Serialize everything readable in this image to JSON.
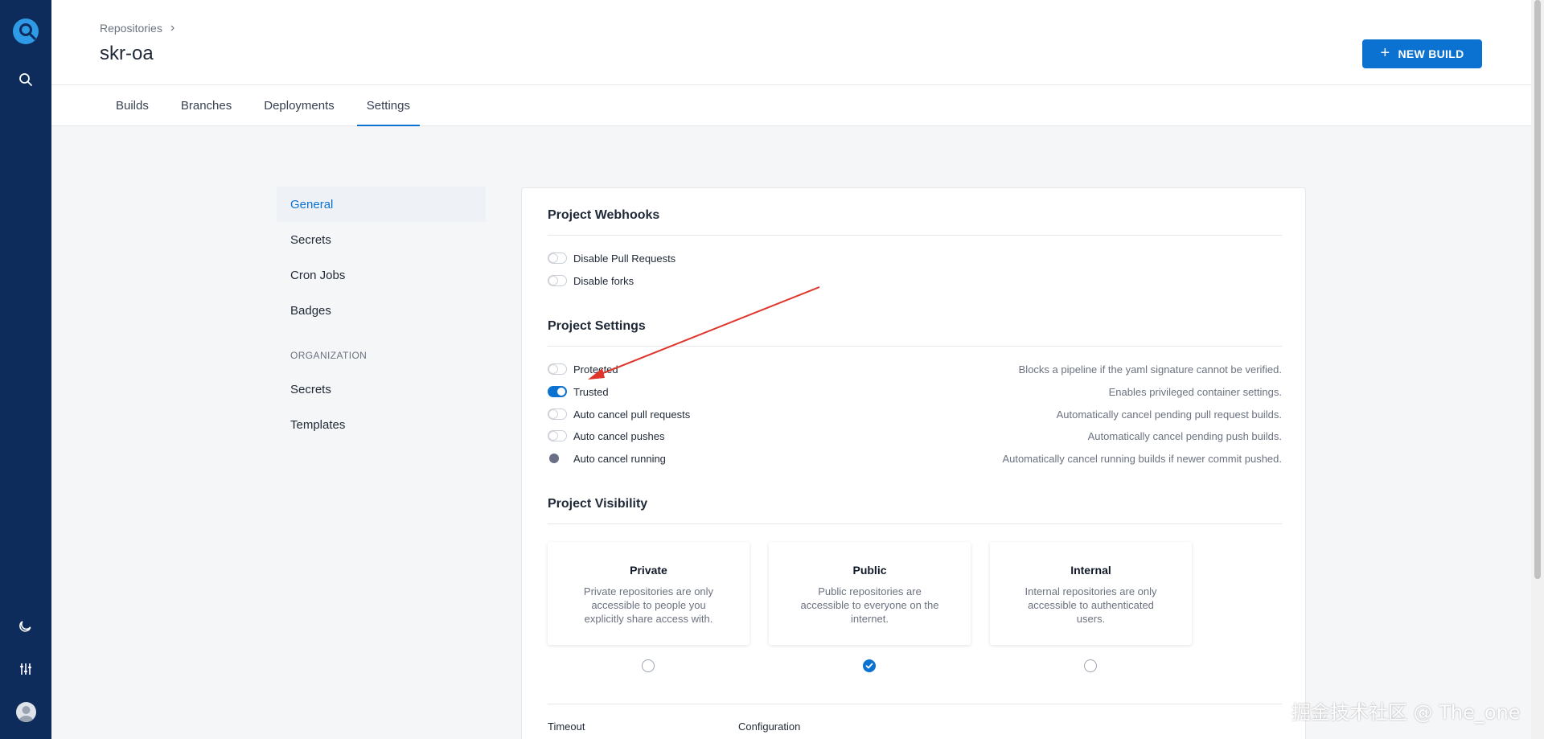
{
  "rail": {
    "icons": [
      "drone-logo-icon",
      "search-icon",
      "moon-icon",
      "sliders-icon",
      "user-avatar-icon"
    ]
  },
  "header": {
    "breadcrumb": "Repositories",
    "title": "skr-oa",
    "new_build_label": "NEW BUILD",
    "tabs": [
      "Builds",
      "Branches",
      "Deployments",
      "Settings"
    ],
    "active_tab": "Settings"
  },
  "settings_nav": {
    "items": [
      "General",
      "Secrets",
      "Cron Jobs",
      "Badges"
    ],
    "active": "General",
    "org_heading": "ORGANIZATION",
    "org_items": [
      "Secrets",
      "Templates"
    ]
  },
  "webhooks": {
    "title": "Project Webhooks",
    "options": [
      {
        "label": "Disable Pull Requests",
        "enabled": false
      },
      {
        "label": "Disable forks",
        "enabled": false
      }
    ]
  },
  "project_settings": {
    "title": "Project Settings",
    "options": [
      {
        "label": "Protected",
        "desc": "Blocks a pipeline if the yaml signature cannot be verified.",
        "enabled": false
      },
      {
        "label": "Trusted",
        "desc": "Enables privileged container settings.",
        "enabled": true
      },
      {
        "label": "Auto cancel pull requests",
        "desc": "Automatically cancel pending pull request builds.",
        "enabled": false
      },
      {
        "label": "Auto cancel pushes",
        "desc": "Automatically cancel pending push builds.",
        "enabled": false
      },
      {
        "label": "Auto cancel running",
        "desc": "Automatically cancel running builds if newer commit pushed.",
        "enabled": false
      }
    ]
  },
  "visibility": {
    "title": "Project Visibility",
    "options": [
      {
        "title": "Private",
        "desc": "Private repositories are only accessible to people you explicitly share access with."
      },
      {
        "title": "Public",
        "desc": "Public repositories are accessible to everyone on the internet."
      },
      {
        "title": "Internal",
        "desc": "Internal repositories are only accessible to authenticated users."
      }
    ],
    "selected": "Public"
  },
  "bottom": {
    "timeout_label": "Timeout",
    "config_label": "Configuration"
  },
  "watermark": "掘金技术社区 @ The_one",
  "colors": {
    "rail": "#0d2c5c",
    "accent": "#0b72d1",
    "annotation_arrow": "#e0352b"
  }
}
